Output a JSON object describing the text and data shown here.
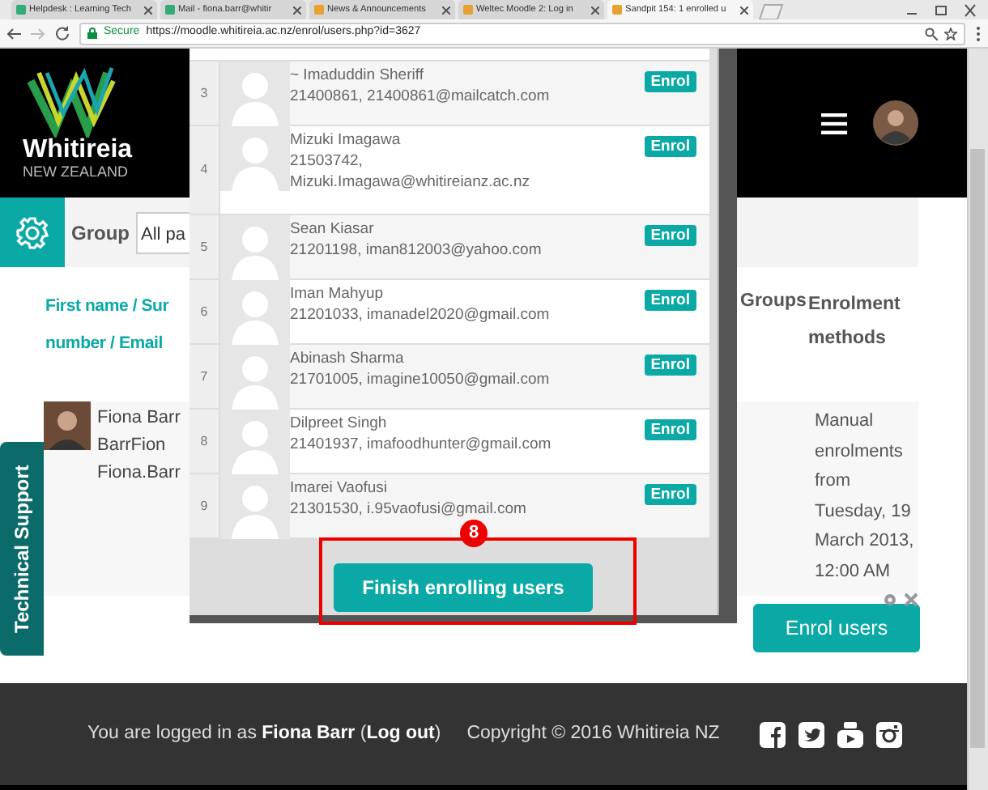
{
  "browser": {
    "tabs": [
      {
        "label": "Helpdesk : Learning Tech",
        "selected": false
      },
      {
        "label": "Mail - fiona.barr@whitir",
        "selected": false
      },
      {
        "label": "News & Announcements",
        "selected": false
      },
      {
        "label": "Weltec Moodle 2: Log in",
        "selected": false
      },
      {
        "label": "Sandpit 154: 1 enrolled u",
        "selected": true
      }
    ],
    "secure_label": "Secure",
    "url": "https://moodle.whitireia.ac.nz/enrol/users.php?id=3627"
  },
  "header": {
    "logo_name": "Whitireia",
    "logo_tagline": "NEW ZEALAND"
  },
  "filter": {
    "label": "Group",
    "select_value": "All pa"
  },
  "table": {
    "columns": [
      {
        "lines": [
          "First name / Sur",
          "number / Email"
        ]
      },
      {
        "lines": [
          "Groups"
        ]
      },
      {
        "lines": [
          "Enrolment methods"
        ]
      }
    ],
    "rows": [
      {
        "name_lines": [
          "Fiona Barr",
          "BarrFion",
          "Fiona.Barr"
        ],
        "enrolment_method": "Manual enrolments from Tuesday, 19 March 2013, 12:00 AM"
      }
    ]
  },
  "enrol_button": "Enrol users",
  "side_tab": "Technical Support",
  "footer": {
    "login_parts": [
      {
        "kind": "text",
        "text": "You are logged in as "
      },
      {
        "kind": "link",
        "text": "Fiona Barr"
      },
      {
        "kind": "text",
        "text": " ("
      },
      {
        "kind": "link",
        "text": "Log out"
      },
      {
        "kind": "text",
        "text": ")"
      }
    ],
    "copyright": "Copyright © 2016 Whitireia NZ"
  },
  "dialog": {
    "users": [
      {
        "number": "3",
        "name": "~ Imaduddin Sheriff",
        "details": "21400861, 21400861@mailcatch.com",
        "action": "Enrol"
      },
      {
        "number": "4",
        "name": "Mizuki Imagawa",
        "details": "21503742, Mizuki.Imagawa@whitireianz.ac.nz",
        "action": "Enrol"
      },
      {
        "number": "5",
        "name": "Sean Kiasar",
        "details": "21201198, iman812003@yahoo.com",
        "action": "Enrol"
      },
      {
        "number": "6",
        "name": "Iman Mahyup",
        "details": "21201033, imanadel2020@gmail.com",
        "action": "Enrol"
      },
      {
        "number": "7",
        "name": "Abinash Sharma",
        "details": "21701005, imagine10050@gmail.com",
        "action": "Enrol"
      },
      {
        "number": "8",
        "name": "Dilpreet Singh",
        "details": "21401937, imafoodhunter@gmail.com",
        "action": "Enrol"
      },
      {
        "number": "9",
        "name": "Imarei Vaofusi",
        "details": "21301530, i.95vaofusi@gmail.com",
        "action": "Enrol"
      }
    ],
    "finish_button": "Finish enrolling users"
  },
  "callout": {
    "number": "8"
  }
}
